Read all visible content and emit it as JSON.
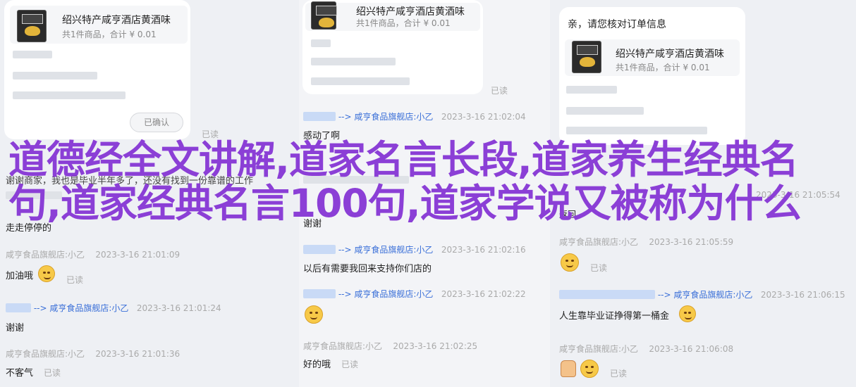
{
  "product": {
    "title": "绍兴特产咸亨酒店黄酒味",
    "subtitle": "共1件商品，合计 ¥ 0.01"
  },
  "col1": {
    "confirm_button": "已确认",
    "read1": "已读",
    "partial_line": "谢谢商家，我也是毕业半年多了，还没有找到一份靠谱的工作",
    "msg_walk": "走走停停的",
    "meta1_sender": "咸亨食品旗舰店:小乙",
    "meta1_time": "2023-3-16 21:01:09",
    "msg_jiayou": "加油哦",
    "read2": "已读",
    "meta2_arrow": "-->",
    "meta2_sender": "咸亨食品旗舰店:小乙",
    "meta2_time": "2023-3-16 21:01:24",
    "msg_thanks": "谢谢",
    "meta3_sender": "咸亨食品旗舰店:小乙",
    "meta3_time": "2023-3-16 21:01:36",
    "msg_nothanks": "不客气",
    "read3": "已读"
  },
  "col2": {
    "read_top": "已读",
    "meta1_arrow": "-->",
    "meta1_sender": "咸亨食品旗舰店:小乙",
    "meta1_time": "2023-3-16 21:02:04",
    "msg_moved": "感动了啊",
    "msg_thanks": "谢谢",
    "meta2_arrow": "-->",
    "meta2_sender": "咸亨食品旗舰店:小乙",
    "meta2_time": "2023-3-16 21:02:16",
    "msg_support": "以后有需要我回来支持你们店的",
    "meta3_arrow": "-->",
    "meta3_sender": "咸亨食品旗舰店:小乙",
    "meta3_time": "2023-3-16 21:02:22",
    "meta4_sender": "咸亨食品旗舰店:小乙",
    "meta4_time": "2023-3-16 21:02:25",
    "msg_ok": "好的哦",
    "read_bottom": "已读"
  },
  "col3": {
    "greeting": "亲，请您核对订单信息",
    "time_partial": "2023-3-16 21:05:54",
    "msg_partial": "返回",
    "meta1_sender": "咸亨食品旗舰店:小乙",
    "meta1_time": "2023-3-16 21:05:59",
    "read1": "已读",
    "meta2_arrow": "-->",
    "meta2_sender": "咸亨食品旗舰店:小乙",
    "meta2_time": "2023-3-16 21:06:15",
    "msg_life": "人生靠毕业证挣得第一桶金",
    "meta3_sender": "咸亨食品旗舰店:小乙",
    "meta3_time": "2023-3-16 21:06:08",
    "read2": "已读"
  },
  "overlay_title": "道德经全文讲解,道家名言长段,道家养生经典名句,道家经典名言100句,道家学说又被称为什么",
  "colors": {
    "overlay": "#8b3fd6",
    "link": "#3a6fd8"
  }
}
